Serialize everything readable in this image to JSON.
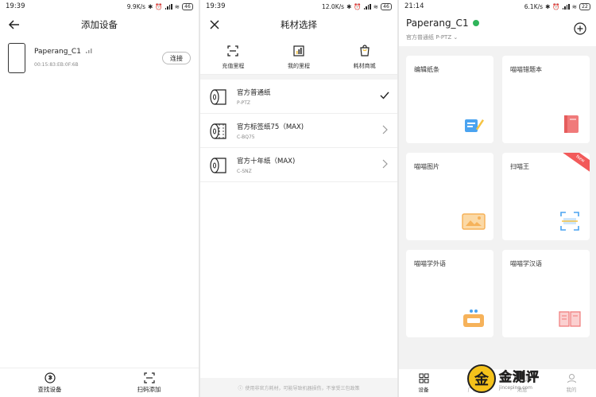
{
  "panel1": {
    "status": {
      "time": "19:39",
      "speed": "9.9K/s",
      "battery": "46"
    },
    "title": "添加设备",
    "device": {
      "name": "Paperang_C1",
      "mac": "00:15:83:EB:0F:6B",
      "connect_label": "连接"
    },
    "bottom": {
      "find_label": "查找设备",
      "scan_label": "扫码添加"
    }
  },
  "panel2": {
    "status": {
      "time": "19:39",
      "speed": "12.0K/s",
      "battery": "46"
    },
    "title": "耗材选择",
    "tabs": [
      {
        "label": "充值里程",
        "icon": "scan-frame-icon"
      },
      {
        "label": "我的里程",
        "icon": "bar-chart-icon"
      },
      {
        "label": "耗材商城",
        "icon": "shopping-bag-icon"
      }
    ],
    "papers": [
      {
        "name": "官方普通纸",
        "code": "P-PTZ",
        "selected": true
      },
      {
        "name": "官方标签纸75（MAX)",
        "code": "C-BQ75",
        "selected": false
      },
      {
        "name": "官方十年纸（MAX)",
        "code": "C-SNZ",
        "selected": false
      }
    ],
    "notice": "使用非官方耗材，可能导致机器损伤，不享受三包政策"
  },
  "panel3": {
    "status": {
      "time": "21:14",
      "speed": "6.1K/s",
      "battery": "22"
    },
    "device_name": "Paperang_C1",
    "paper_type": "官方普通纸 P-PTZ",
    "cards": [
      {
        "title": "编辑纸条",
        "icon": "note-edit-icon",
        "colors": [
          "#4aa3f0",
          "#f5c342"
        ]
      },
      {
        "title": "喵喵错题本",
        "icon": "notebook-icon",
        "colors": [
          "#f07a7a",
          "#e65c5c"
        ]
      },
      {
        "title": "喵喵图片",
        "icon": "picture-icon",
        "colors": [
          "#f6b25a",
          "#fbd9a6"
        ]
      },
      {
        "title": "扫喵王",
        "icon": "scanner-icon",
        "colors": [
          "#4aa3f0",
          "#f5c342"
        ],
        "new_tag": "New"
      },
      {
        "title": "喵喵学外语",
        "icon": "radio-icon",
        "colors": [
          "#f6b25a",
          "#4aa3f0"
        ]
      },
      {
        "title": "喵喵学汉语",
        "icon": "book-icon",
        "colors": [
          "#f07a7a",
          "#fbd0d0"
        ]
      }
    ],
    "bottom": [
      {
        "label": "设备",
        "active": true
      },
      {
        "label": "广场",
        "active": false
      },
      {
        "label": "消息",
        "active": false
      },
      {
        "label": "我的",
        "active": false
      }
    ],
    "watermark": {
      "brand": "金测评",
      "url": "jinceping.com",
      "logo_char": "金"
    }
  }
}
